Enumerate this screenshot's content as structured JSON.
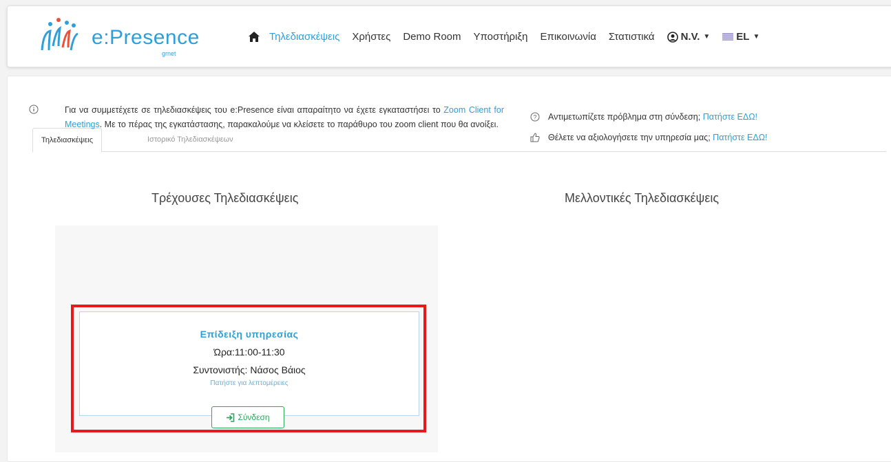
{
  "brand": {
    "name_prefix": "e",
    "name_colon": ":",
    "name_suffix": "Presence",
    "sub": "grnet"
  },
  "nav": {
    "items": [
      {
        "label": "Τηλεδιασκέψεις",
        "active": true
      },
      {
        "label": "Χρήστες"
      },
      {
        "label": "Demo Room"
      },
      {
        "label": "Υποστήριξη"
      },
      {
        "label": "Επικοινωνία"
      },
      {
        "label": "Στατιστικά"
      }
    ],
    "user": "N.V.",
    "lang": "EL"
  },
  "tabs": [
    {
      "label": "Τηλεδιασκέψεις",
      "active": true
    },
    {
      "label": "Ιστορικό Τηλεδιασκέψεων"
    }
  ],
  "info": {
    "text_before": "Για να συμμετέχετε σε τηλεδιασκέψεις του e:Presence είναι απαραίτητο να έχετε εγκαταστήσει το ",
    "link": "Zoom Client for Meetings",
    "text_after": ". Με το πέρας της εγκατάστασης, παρακαλούμε να κλείσετε το παράθυρο του zoom client που θα ανοίξει."
  },
  "help": {
    "problem_text": "Αντιμετωπίζετε πρόβλημα στη σύνδεση;",
    "problem_link": "Πατήστε ΕΔΩ!",
    "rate_text": "Θέλετε να αξιολογήσετε την υπηρεσία μας;",
    "rate_link": "Πατήστε ΕΔΩ!"
  },
  "sections": {
    "current": "Τρέχουσες Τηλεδιασκέψεις",
    "future": "Μελλοντικές Τηλεδιασκέψεις"
  },
  "meeting": {
    "title": "Επίδειξη υπηρεσίας",
    "time": "Ώρα:11:00-11:30",
    "coordinator": "Συντονιστής: Νάσος Βάιος",
    "details": "Πατήστε για λεπτομέρειες",
    "connect": "Σύνδεση"
  },
  "colors": {
    "accent": "#2e9fd8",
    "success": "#2aa85a",
    "highlight": "#e8191a"
  }
}
